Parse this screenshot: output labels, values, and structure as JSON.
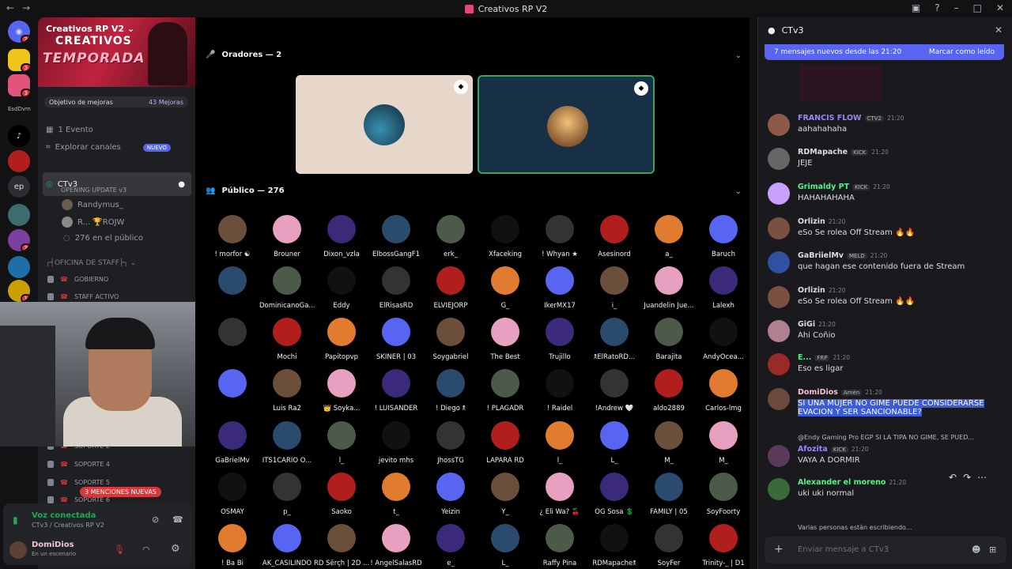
{
  "window": {
    "title": "Creativos RP V2"
  },
  "server": {
    "name": "Creativos RP V2",
    "banner_line1": "CREATIVOS",
    "banner_line2": "TEMPORADA 2",
    "goal": "Objetivo de mejoras",
    "goal_count": "43 Mejoras"
  },
  "server_rail": {
    "labels": [
      "EsdDvm",
      "ep"
    ],
    "badges": [
      "3",
      "3",
      "3",
      "3",
      "1"
    ]
  },
  "channels": {
    "events": "1 Evento",
    "explore": "Explorar canales",
    "new_badge": "NUEVO",
    "selected": {
      "name": "CTv3",
      "sub": "OPENING UPDATE v3"
    },
    "voice_users": [
      "Randymus_",
      "R... 🏆ROJW"
    ],
    "audience": "276 en el público",
    "category": "OFICINA DE STAFF",
    "locked": [
      "GOBIERNO",
      "STAFF ACTIVO",
      "SOPORTE 2",
      "SOPORTE 4",
      "SOPORTE 5",
      "SOPORTE 6"
    ]
  },
  "mentions": "3 MENCIONES NUEVAS",
  "voice_panel": {
    "status": "Voz conectada",
    "location": "CTv3 / Creativos RP V2",
    "user": "DomiDios",
    "user_state": "En un escenario"
  },
  "stage": {
    "speakers_label": "Oradores — 2",
    "audience_label": "Público — 276",
    "audience_members": [
      [
        "! morfor ☯",
        "Brouner",
        "Dixon_vzla",
        "ElbossGangF1",
        "erk_",
        "Xfaceking",
        "! Whyan ★",
        "Asesinord",
        "a_",
        "Baruch"
      ],
      [
        "",
        "DominicanoGa...",
        "Eddy",
        "ElRisasRD",
        "ELVIEJORP",
        "G_",
        "IkerMX17",
        "i_",
        "Juandelin Jue...",
        "Lalexh"
      ],
      [
        "",
        "Mochi",
        "Papitopvp",
        "SKINER | 03",
        "Soygabriel",
        "The Best",
        "Trujillo",
        "🕱ElRatoRD...",
        "Barajita",
        "AndyOcea..."
      ],
      [
        "",
        "Luis Ra2",
        "👑 Soyka...",
        "! LUISANDER",
        "! Diego 🕱",
        "! PLAGADR",
        "! Raidel",
        "!Andrew 🤍",
        "aldo2889",
        "Carlos-lmg"
      ],
      [
        "GaBrielMv",
        "ITS1CARIO O...",
        "l_",
        "jevito mhs",
        "JhossTG",
        "LAPARA RD",
        "l_",
        "L_",
        "M_",
        "M_"
      ],
      [
        "OSMAY",
        "p_",
        "Saoko",
        "t_",
        "Yeizin",
        "Y_",
        "¿ Eli Wa? 🍒",
        "OG Sosa 💲",
        "FAMILY | 05",
        "SoyFoorty"
      ],
      [
        "! Ba Bi",
        "AK_CASILINDO",
        "RD Šërçh | 2D ...",
        "! AngelSalasRD",
        "e_",
        "L_",
        "Raffy Pina",
        "RDMapache🕱",
        "SoyFer",
        "Trinity-_ | D1"
      ]
    ]
  },
  "chat": {
    "channel": "CTv3",
    "new_messages": "7 mensajes nuevos desde las 21:20",
    "mark_read": "Marcar como leído",
    "messages": [
      {
        "name": "FRANCIS FLOW",
        "tag": "CTV2",
        "time": "21:20",
        "text": "aahahahaha",
        "color": "#9b84ff"
      },
      {
        "name": "RDMapache",
        "tag": "KICK",
        "time": "21:20",
        "text": "JEJE",
        "color": "#dbdee1"
      },
      {
        "name": "Grimaldy PT",
        "tag": "KICK",
        "time": "21:20",
        "text": "HAHAHAHAHA",
        "color": "#57f287"
      },
      {
        "name": "Orlizin",
        "tag": "",
        "time": "21:20",
        "text": "eSo Se rolea Off Stream 🔥🔥",
        "color": "#dbdee1"
      },
      {
        "name": "GaBriielMv",
        "tag": "MELD",
        "time": "21:20",
        "text": "que hagan ese contenido fuera de Stream",
        "color": "#dbdee1"
      },
      {
        "name": "Orlizin",
        "tag": "",
        "time": "21:20",
        "text": "eSo Se rolea Off Stream 🔥🔥",
        "color": "#dbdee1"
      },
      {
        "name": "GiGi",
        "tag": "",
        "time": "21:20",
        "text": "Ahi Coñio",
        "color": "#dbdee1"
      },
      {
        "name": "E...",
        "tag": "FRP",
        "time": "21:20",
        "text": "Eso es ligar",
        "color": "#57f287"
      },
      {
        "name": "DomiDios",
        "tag": "Amén",
        "time": "21:20",
        "text": "SI UNA MUJER NO GIME PUEDE CONSIDERARSE",
        "text2": "EVACION Y SER SANCIONABLE?",
        "color": "#f0c3d3"
      },
      {
        "name": "Afozita",
        "tag": "KICK",
        "time": "21:20",
        "text": "VAYA A DORMIR",
        "color": "#9b84ff"
      },
      {
        "name": "Alexander el moreno",
        "tag": "",
        "time": "21:20",
        "text": "uki uki normal",
        "color": "#57f287"
      }
    ],
    "reply_preview": "@Endy Gaming Pro  EGP  SI LA TIPA NO GIME, SE PUED...",
    "typing": "Varias personas están escribiendo...",
    "composer_placeholder": "Enviar mensaje a CTv3"
  }
}
